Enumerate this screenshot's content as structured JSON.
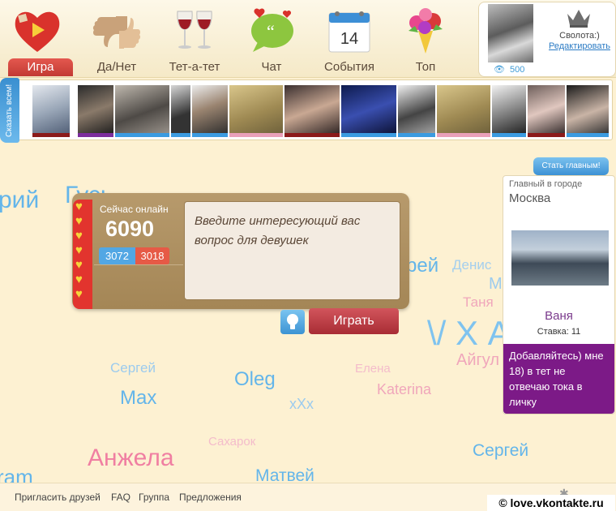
{
  "nav": {
    "items": [
      {
        "label": "Игра",
        "icon": "heart-play-icon",
        "active": true
      },
      {
        "label": "Да/Нет",
        "icon": "thumbs-up-down-icon"
      },
      {
        "label": "Тет-а-тет",
        "icon": "wine-glasses-icon"
      },
      {
        "label": "Чат",
        "icon": "chat-bubble-icon"
      },
      {
        "label": "События",
        "icon": "calendar-icon",
        "calendar_day": "14"
      },
      {
        "label": "Топ",
        "icon": "bouquet-icon"
      }
    ]
  },
  "profile": {
    "name": "Сволота:)",
    "edit_link": "Редактировать",
    "views": "500"
  },
  "strip": {
    "say_all": "Сказать всем!",
    "stripe_colors": [
      "#8b1a1a",
      "#7c2c9c",
      "#3b9be0",
      "#3b9be0",
      "#3b9be0",
      "#e9a0b9",
      "#8b1a1a",
      "#3b9be0",
      "#3b9be0",
      "#e9a0b9",
      "#3b9be0",
      "#8b1a1a",
      "#3b9be0",
      "#3b9be0"
    ]
  },
  "cloud": {
    "words": [
      {
        "t": "рий",
        "c": "#63b5ea"
      },
      {
        "t": "Гусь",
        "c": "#63b5ea"
      },
      {
        "t": "рей",
        "c": "#63b5ea"
      },
      {
        "t": "Денис",
        "c": "#a4cfee"
      },
      {
        "t": "М",
        "c": "#9ccbee"
      },
      {
        "t": "Таня",
        "c": "#f0a6bb"
      },
      {
        "t": "\\/ Х А",
        "c": "#7fc3ef"
      },
      {
        "t": "Айгул",
        "c": "#f0a6bb"
      },
      {
        "t": "Сергей",
        "c": "#9ccbee"
      },
      {
        "t": "Max",
        "c": "#63b5ea"
      },
      {
        "t": "Oleg",
        "c": "#63b5ea"
      },
      {
        "t": "хХх",
        "c": "#9ccbee"
      },
      {
        "t": "Елена",
        "c": "#f4bccb"
      },
      {
        "t": "Katerina",
        "c": "#f0a6bb"
      },
      {
        "t": "Сахарок",
        "c": "#f4bccb"
      },
      {
        "t": "Анжела",
        "c": "#f07fa2"
      },
      {
        "t": "Сергей",
        "c": "#63b5ea"
      },
      {
        "t": "ram",
        "c": "#63b5ea"
      },
      {
        "t": "Матвей",
        "c": "#63b5ea"
      }
    ]
  },
  "game": {
    "online_label": "Сейчас онлайн",
    "online_count": "6090",
    "male_count": "3072",
    "female_count": "3018",
    "question_placeholder": "Введите интересующий вас вопрос для девушек",
    "play_button": "Играть"
  },
  "city": {
    "make_main_button": "Стать главным!",
    "caption": "Главный в городе",
    "city_name": "Москва",
    "user_name": "Ваня",
    "bid": "Ставка: 11",
    "message": "Добавляйтесь) мне 18) в тет не отвечаю тока в личку"
  },
  "footer": {
    "links": [
      "Пригласить друзей",
      "FAQ",
      "Группа",
      "Предложения"
    ],
    "watermark": "© love.vkontakte.ru"
  }
}
